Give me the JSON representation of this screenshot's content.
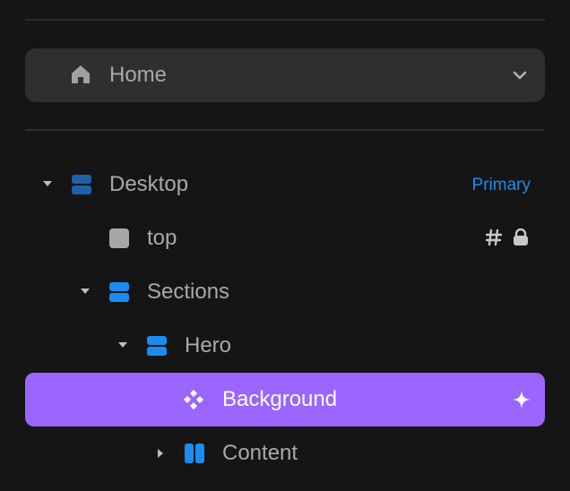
{
  "page_selector": {
    "label": "Home",
    "icon": "home-icon",
    "dropdown_icon": "chevron-down-icon"
  },
  "layers": [
    {
      "name": "Desktop",
      "icon": "stack-icon",
      "expanded": true,
      "badge": "Primary",
      "selected": false
    },
    {
      "name": "top",
      "icon": "frame-square-icon",
      "expanded": null,
      "right_icons": [
        "hash-icon",
        "lock-icon"
      ],
      "selected": false
    },
    {
      "name": "Sections",
      "icon": "stack-icon",
      "expanded": true,
      "selected": false
    },
    {
      "name": "Hero",
      "icon": "stack-icon",
      "expanded": true,
      "selected": false
    },
    {
      "name": "Background",
      "icon": "component-icon",
      "expanded": null,
      "right_icons": [
        "sparkle-icon"
      ],
      "selected": true
    },
    {
      "name": "Content",
      "icon": "columns-icon",
      "expanded": false,
      "selected": false
    }
  ],
  "colors": {
    "background": "#151515",
    "selected": "#9a66ff",
    "accent_blue": "#1a8cf0",
    "text": "#a9a9a9"
  }
}
